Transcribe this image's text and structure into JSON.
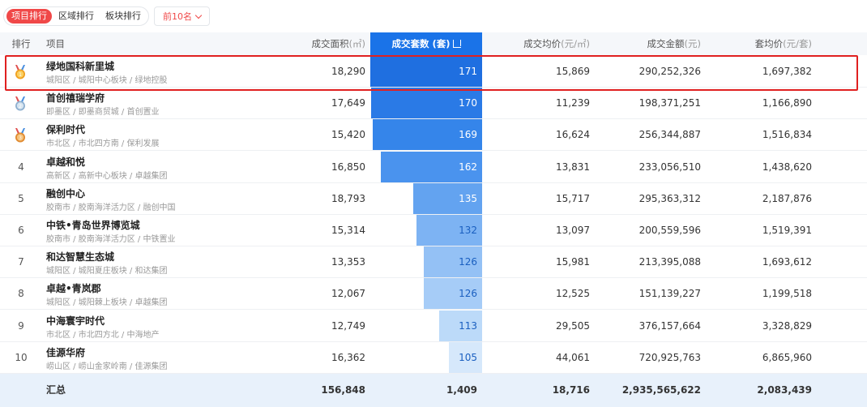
{
  "tabs": [
    {
      "label": "项目排行",
      "active": true
    },
    {
      "label": "区域排行",
      "active": false
    },
    {
      "label": "板块排行",
      "active": false
    }
  ],
  "filter": {
    "label": "前10名"
  },
  "headers": {
    "rank": "排行",
    "project": "项目",
    "area": "成交面积",
    "area_unit": "(㎡)",
    "units": "成交套数",
    "units_unit": "(套)",
    "avg_price": "成交均价",
    "avg_price_unit": "(元/㎡)",
    "amount": "成交金额",
    "amount_unit": "(元)",
    "unit_price": "套均价",
    "unit_price_unit": "(元/套)"
  },
  "rows": [
    {
      "rank": "1",
      "medal": "gold",
      "name": "绿地国科新里城",
      "sub": "城阳区 / 城阳中心板块 / 绿地控股",
      "area": "18,290",
      "units": "171",
      "units_value": 171,
      "avg_price": "15,869",
      "amount": "290,252,326",
      "unit_price": "1,697,382"
    },
    {
      "rank": "2",
      "medal": "silver",
      "name": "首创禧瑞学府",
      "sub": "即墨区 / 即墨商贸城 / 首创置业",
      "area": "17,649",
      "units": "170",
      "units_value": 170,
      "avg_price": "11,239",
      "amount": "198,371,251",
      "unit_price": "1,166,890"
    },
    {
      "rank": "3",
      "medal": "bronze",
      "name": "保利时代",
      "sub": "市北区 / 市北四方南 / 保利发展",
      "area": "15,420",
      "units": "169",
      "units_value": 169,
      "avg_price": "16,624",
      "amount": "256,344,887",
      "unit_price": "1,516,834"
    },
    {
      "rank": "4",
      "medal": "",
      "name": "卓越和悦",
      "sub": "高新区 / 高新中心板块 / 卓越集团",
      "area": "16,850",
      "units": "162",
      "units_value": 162,
      "avg_price": "13,831",
      "amount": "233,056,510",
      "unit_price": "1,438,620"
    },
    {
      "rank": "5",
      "medal": "",
      "name": "融创中心",
      "sub": "胶南市 / 胶南海洋活力区 / 融创中国",
      "area": "18,793",
      "units": "135",
      "units_value": 135,
      "avg_price": "15,717",
      "amount": "295,363,312",
      "unit_price": "2,187,876"
    },
    {
      "rank": "6",
      "medal": "",
      "name": "中铁•青岛世界博览城",
      "sub": "胶南市 / 胶南海洋活力区 / 中铁置业",
      "area": "15,314",
      "units": "132",
      "units_value": 132,
      "avg_price": "13,097",
      "amount": "200,559,596",
      "unit_price": "1,519,391"
    },
    {
      "rank": "7",
      "medal": "",
      "name": "和达智慧生态城",
      "sub": "城阳区 / 城阳夏庄板块 / 和达集团",
      "area": "13,353",
      "units": "126",
      "units_value": 126,
      "avg_price": "15,981",
      "amount": "213,395,088",
      "unit_price": "1,693,612"
    },
    {
      "rank": "8",
      "medal": "",
      "name": "卓越•青岚郡",
      "sub": "城阳区 / 城阳棘上板块 / 卓越集团",
      "area": "12,067",
      "units": "126",
      "units_value": 126,
      "avg_price": "12,525",
      "amount": "151,139,227",
      "unit_price": "1,199,518"
    },
    {
      "rank": "9",
      "medal": "",
      "name": "中海寰宇时代",
      "sub": "市北区 / 市北四方北 / 中海地产",
      "area": "12,749",
      "units": "113",
      "units_value": 113,
      "avg_price": "29,505",
      "amount": "376,157,664",
      "unit_price": "3,328,829"
    },
    {
      "rank": "10",
      "medal": "",
      "name": "佳源华府",
      "sub": "崂山区 / 崂山金家岭南 / 佳源集团",
      "area": "16,362",
      "units": "105",
      "units_value": 105,
      "avg_price": "44,061",
      "amount": "720,925,763",
      "unit_price": "6,865,960"
    }
  ],
  "summary": {
    "label": "汇总",
    "area": "156,848",
    "units": "1,409",
    "avg_price": "18,716",
    "amount": "2,935,565,622",
    "unit_price": "2,083,439"
  },
  "colors": {
    "accent": "#f04848",
    "selected_column": "#1a73e8",
    "highlight_border": "#e02020",
    "bar_colors": [
      "#1f6fe0",
      "#2a7ae6",
      "#3585ea",
      "#4a93ee",
      "#63a3f0",
      "#7db3f3",
      "#94c1f5",
      "#a6ccf7",
      "#bcdaf9",
      "#d6e8fb"
    ]
  }
}
